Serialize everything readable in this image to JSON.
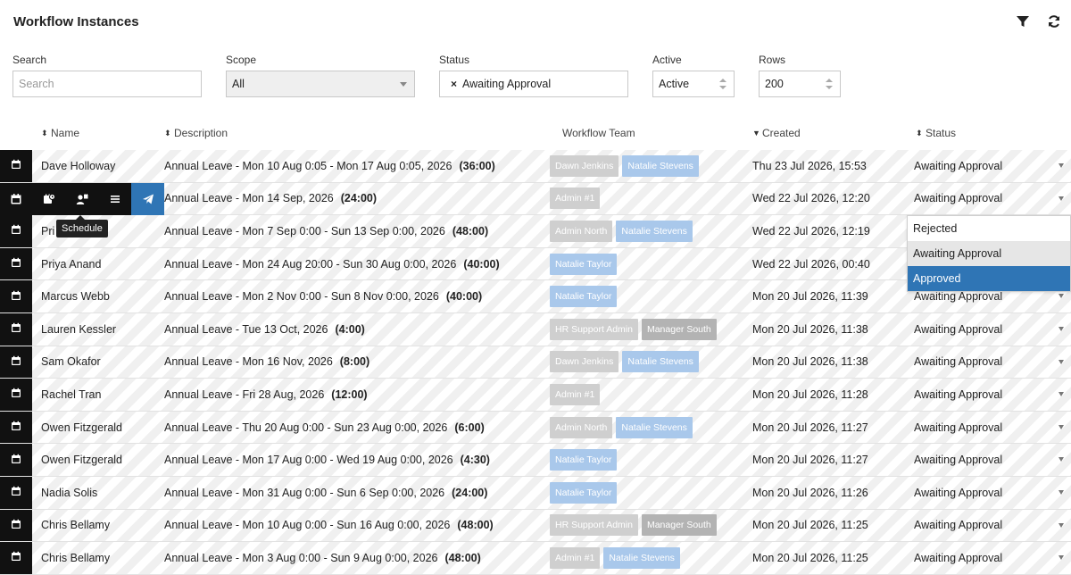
{
  "page": {
    "title": "Workflow Instances"
  },
  "filters": {
    "search_label": "Search",
    "search_placeholder": "Search",
    "scope_label": "Scope",
    "scope_value": "All",
    "status_label": "Status",
    "status_chip": "Awaiting Approval",
    "status_chip_remove": "×",
    "active_label": "Active",
    "active_value": "Active",
    "rows_label": "Rows",
    "rows_value": "200"
  },
  "columns": {
    "name": "Name",
    "description": "Description",
    "team": "Workflow Team",
    "created": "Created",
    "status": "Status"
  },
  "rows": [
    {
      "name": "Dave Holloway",
      "desc": "Annual Leave - Mon 10 Aug 0:05 - Mon 17 Aug 0:05, 2026",
      "dur": "(36:00)",
      "team": [
        {
          "t": "Dawn Jenkins",
          "c": "gray"
        },
        {
          "t": "Natalie Stevens",
          "c": "blue"
        }
      ],
      "created": "Thu 23 Jul 2026, 15:53",
      "status": "Awaiting Approval"
    },
    {
      "name": "",
      "desc": "Annual Leave - Mon 14 Sep, 2026",
      "dur": "(24:00)",
      "team": [
        {
          "t": "Admin #1",
          "c": "gray"
        }
      ],
      "created": "Wed 22 Jul 2026, 12:20",
      "status": "Awaiting Approval"
    },
    {
      "name": "Pri",
      "desc": "Annual Leave - Mon 7 Sep 0:00 - Sun 13 Sep 0:00, 2026",
      "dur": "(48:00)",
      "team": [
        {
          "t": "Admin North",
          "c": "gray"
        },
        {
          "t": "Natalie Stevens",
          "c": "blue"
        }
      ],
      "created": "Wed 22 Jul 2026, 12:19",
      "status": ""
    },
    {
      "name": "Priya Anand",
      "desc": "Annual Leave - Mon 24 Aug 20:00 - Sun 30 Aug 0:00, 2026",
      "dur": "(40:00)",
      "team": [
        {
          "t": "Natalie Taylor",
          "c": "blue"
        }
      ],
      "created": "Wed 22 Jul 2026, 00:40",
      "status": ""
    },
    {
      "name": "Marcus Webb",
      "desc": "Annual Leave - Mon 2 Nov 0:00 - Sun 8 Nov 0:00, 2026",
      "dur": "(40:00)",
      "team": [
        {
          "t": "Natalie Taylor",
          "c": "blue"
        }
      ],
      "created": "Mon 20 Jul 2026, 11:39",
      "status": "Awaiting Approval"
    },
    {
      "name": "Lauren Kessler",
      "desc": "Annual Leave - Tue 13 Oct, 2026",
      "dur": "(4:00)",
      "team": [
        {
          "t": "HR Support Admin",
          "c": "gray"
        },
        {
          "t": "Manager South",
          "c": "manager"
        }
      ],
      "created": "Mon 20 Jul 2026, 11:38",
      "status": "Awaiting Approval"
    },
    {
      "name": "Sam Okafor",
      "desc": "Annual Leave - Mon 16 Nov, 2026",
      "dur": "(8:00)",
      "team": [
        {
          "t": "Dawn Jenkins",
          "c": "gray"
        },
        {
          "t": "Natalie Stevens",
          "c": "blue"
        }
      ],
      "created": "Mon 20 Jul 2026, 11:38",
      "status": "Awaiting Approval"
    },
    {
      "name": "Rachel Tran",
      "desc": "Annual Leave - Fri 28 Aug, 2026",
      "dur": "(12:00)",
      "team": [
        {
          "t": "Admin #1",
          "c": "gray"
        }
      ],
      "created": "Mon 20 Jul 2026, 11:28",
      "status": "Awaiting Approval"
    },
    {
      "name": "Owen Fitzgerald",
      "desc": "Annual Leave - Thu 20 Aug 0:00 - Sun 23 Aug 0:00, 2026",
      "dur": "(6:00)",
      "team": [
        {
          "t": "Admin North",
          "c": "gray"
        },
        {
          "t": "Natalie Stevens",
          "c": "blue"
        }
      ],
      "created": "Mon 20 Jul 2026, 11:27",
      "status": "Awaiting Approval"
    },
    {
      "name": "Owen Fitzgerald",
      "desc": "Annual Leave - Mon 17 Aug 0:00 - Wed 19 Aug 0:00, 2026",
      "dur": "(4:30)",
      "team": [
        {
          "t": "Natalie Taylor",
          "c": "blue"
        }
      ],
      "created": "Mon 20 Jul 2026, 11:27",
      "status": "Awaiting Approval"
    },
    {
      "name": "Nadia Solis",
      "desc": "Annual Leave - Mon 31 Aug 0:00 - Sun 6 Sep 0:00, 2026",
      "dur": "(24:00)",
      "team": [
        {
          "t": "Natalie Taylor",
          "c": "blue"
        }
      ],
      "created": "Mon 20 Jul 2026, 11:26",
      "status": "Awaiting Approval"
    },
    {
      "name": "Chris Bellamy",
      "desc": "Annual Leave - Mon 10 Aug 0:00 - Sun 16 Aug 0:00, 2026",
      "dur": "(48:00)",
      "team": [
        {
          "t": "HR Support Admin",
          "c": "gray"
        },
        {
          "t": "Manager South",
          "c": "manager"
        }
      ],
      "created": "Mon 20 Jul 2026, 11:25",
      "status": "Awaiting Approval"
    },
    {
      "name": "Chris Bellamy",
      "desc": "Annual Leave - Mon 3 Aug 0:00 - Sun 9 Aug 0:00, 2026",
      "dur": "(48:00)",
      "team": [
        {
          "t": "Admin #1",
          "c": "gray"
        },
        {
          "t": "Natalie Stevens",
          "c": "blue"
        }
      ],
      "created": "Mon 20 Jul 2026, 11:25",
      "status": "Awaiting Approval"
    }
  ],
  "row_actions": {
    "tooltip": "Schedule"
  },
  "status_dropdown": {
    "options": [
      "Rejected",
      "Awaiting Approval",
      "Approved"
    ],
    "hovered": "Awaiting Approval",
    "selected": "Approved"
  },
  "icons": {
    "filter": "filter-icon",
    "refresh": "refresh-icon",
    "calendar": "calendar-icon",
    "send": "paper-plane-icon"
  },
  "colors": {
    "accent": "#2f75b5",
    "row_button": "#111111",
    "tag_blue": "#a9c8eb",
    "tag_gray": "#cfcfcf"
  }
}
